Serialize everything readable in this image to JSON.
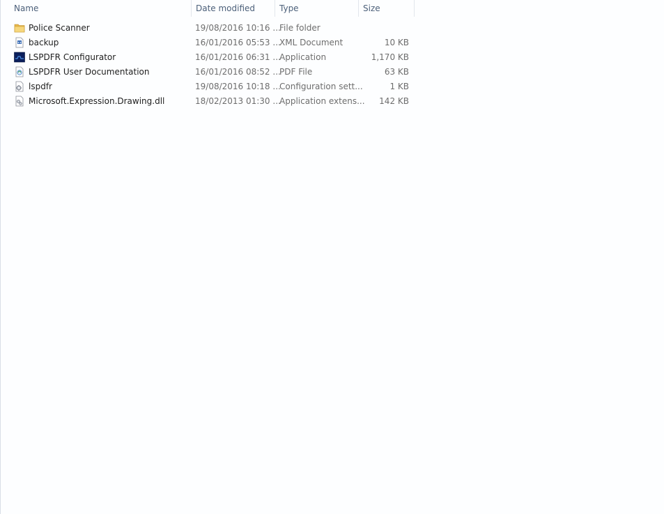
{
  "columns": {
    "name": "Name",
    "date": "Date modified",
    "type": "Type",
    "size": "Size"
  },
  "files": [
    {
      "name": "Police Scanner",
      "date": "19/08/2016 10:16 ...",
      "type": "File folder",
      "size": "",
      "icon": "folder-icon"
    },
    {
      "name": "backup",
      "date": "16/01/2016 05:53 ...",
      "type": "XML Document",
      "size": "10 KB",
      "icon": "xml-document-icon"
    },
    {
      "name": "LSPDFR Configurator",
      "date": "16/01/2016 06:31 ...",
      "type": "Application",
      "size": "1,170 KB",
      "icon": "application-icon"
    },
    {
      "name": "LSPDFR User Documentation",
      "date": "16/01/2016 08:52 ...",
      "type": "PDF File",
      "size": "63 KB",
      "icon": "pdf-file-icon"
    },
    {
      "name": "lspdfr",
      "date": "19/08/2016 10:18 ...",
      "type": "Configuration sett...",
      "size": "1 KB",
      "icon": "config-file-icon"
    },
    {
      "name": "Microsoft.Expression.Drawing.dll",
      "date": "18/02/2013 01:30 ...",
      "type": "Application extens...",
      "size": "142 KB",
      "icon": "dll-file-icon"
    }
  ]
}
